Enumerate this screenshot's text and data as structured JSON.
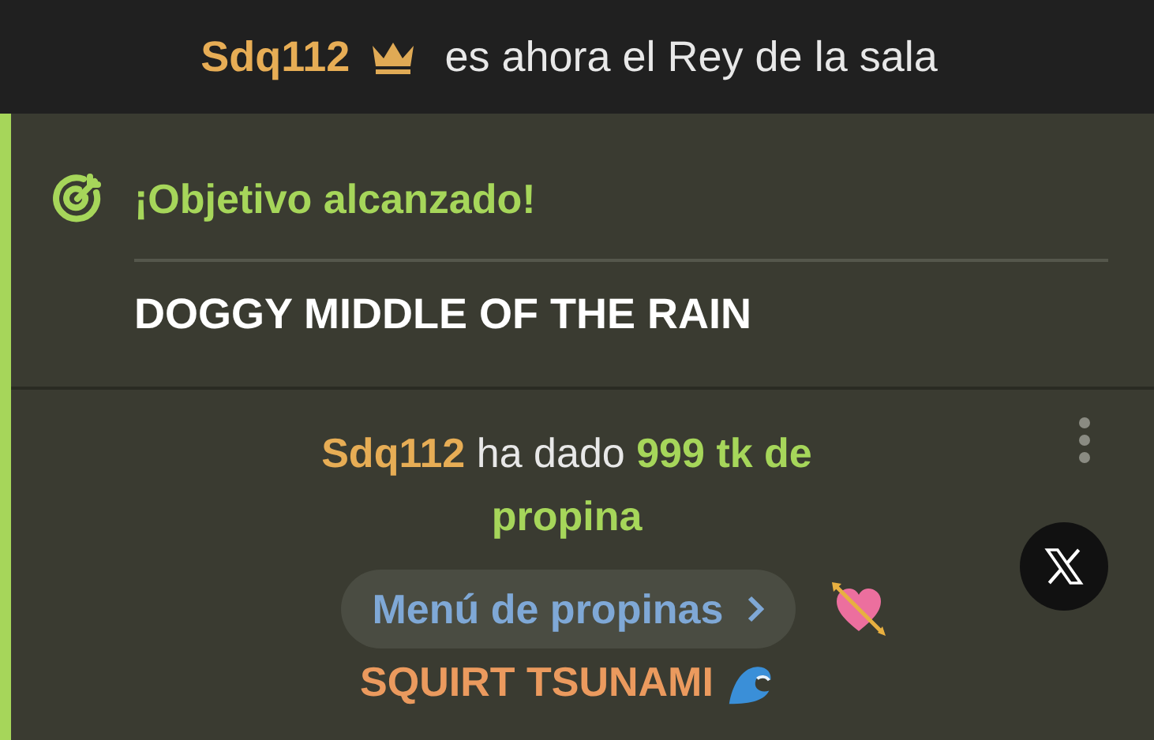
{
  "king_banner": {
    "username": "Sdq112",
    "text": "es ahora el Rey de la sala"
  },
  "goal": {
    "title": "¡Objetivo alcanzado!",
    "name": "DOGGY MIDDLE OF THE RAIN"
  },
  "tip": {
    "username": "Sdq112",
    "action": "ha dado",
    "amount": "999 tk de propina",
    "menu_button": "Menú de propinas",
    "item": "SQUIRT TSUNAMI"
  }
}
